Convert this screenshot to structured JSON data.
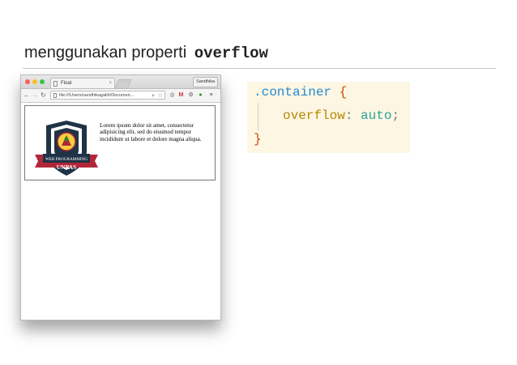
{
  "slide": {
    "title_text": "menggunakan properti",
    "title_code": "overflow"
  },
  "browser": {
    "tab_title": "Float",
    "tab_close": "×",
    "profile_name": "Sandhika",
    "address": "file:///Users/sandhikagalih/Documen...",
    "content": {
      "paragraph": "Lorem ipsum dolor sit amet, consectetur adipisicing elit, sed do eiusmod tempor incididunt ut labore et dolore magna aliqua.",
      "badge_text_top": "WEB PROGRAMMING",
      "badge_text_bottom": "UNPAS"
    }
  },
  "code": {
    "selector": ".container",
    "open_brace": "{",
    "property": "overflow",
    "colon": ":",
    "value": "auto",
    "semicolon": ";",
    "close_brace": "}"
  },
  "colors": {
    "selector": "#268bd2",
    "brace": "#cb4b16",
    "property": "#b58900",
    "value": "#2aa198",
    "code_bg": "#fdf6e3",
    "badge_navy": "#1f3346",
    "badge_red": "#b3263a",
    "badge_yellow": "#f4d03f"
  },
  "icons": [
    "back-icon",
    "forward-icon",
    "reload-icon",
    "page-icon",
    "zoom-icon",
    "star-icon",
    "extension-icon",
    "gmail-icon",
    "gear-icon",
    "evernote-icon",
    "menu-icon"
  ]
}
